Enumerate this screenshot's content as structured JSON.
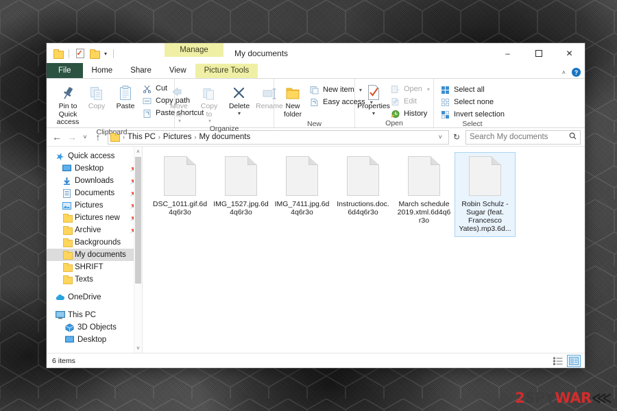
{
  "window": {
    "title": "My documents",
    "contextual_tab_title": "Manage",
    "contextual_tab_sub": "Picture Tools",
    "minimize": "–",
    "maximize": "☐",
    "close": "✕",
    "collapse_ribbon": "˄",
    "help": "?"
  },
  "quick_access_toolbar": {
    "new_folder": "new-folder-icon",
    "properties": "properties-icon",
    "folder": "folder-icon",
    "customize": "▾"
  },
  "tabs": [
    {
      "label": "File",
      "kind": "file"
    },
    {
      "label": "Home",
      "kind": "active"
    },
    {
      "label": "Share",
      "kind": "normal"
    },
    {
      "label": "View",
      "kind": "normal"
    },
    {
      "label": "Picture Tools",
      "kind": "contextual"
    }
  ],
  "ribbon": {
    "groups": [
      {
        "label": "Clipboard",
        "big": [
          {
            "label": "Pin to Quick\naccess",
            "icon": "pin-icon",
            "dim": false
          },
          {
            "label": "Copy",
            "icon": "copy-icon",
            "dim": true
          },
          {
            "label": "Paste",
            "icon": "paste-icon",
            "dim": false
          }
        ],
        "small": [
          {
            "label": "Cut",
            "icon": "scissors-icon",
            "dim": false
          },
          {
            "label": "Copy path",
            "icon": "copy-path-icon",
            "dim": false
          },
          {
            "label": "Paste shortcut",
            "icon": "paste-shortcut-icon",
            "dim": false
          }
        ]
      },
      {
        "label": "Organize",
        "big": [
          {
            "label": "Move\nto",
            "icon": "move-to-icon",
            "dim": true,
            "caret": true
          },
          {
            "label": "Copy\nto",
            "icon": "copy-to-icon",
            "dim": true,
            "caret": true
          },
          {
            "label": "Delete",
            "icon": "delete-icon",
            "dim": false,
            "caret": true
          },
          {
            "label": "Rename",
            "icon": "rename-icon",
            "dim": true
          }
        ],
        "small": []
      },
      {
        "label": "New",
        "big": [
          {
            "label": "New\nfolder",
            "icon": "new-folder-icon",
            "dim": false
          }
        ],
        "small": [
          {
            "label": "New item",
            "icon": "new-item-icon",
            "dim": false,
            "caret": true
          },
          {
            "label": "Easy access",
            "icon": "easy-access-icon",
            "dim": false,
            "caret": true
          }
        ]
      },
      {
        "label": "Open",
        "big": [
          {
            "label": "Properties",
            "icon": "properties-icon",
            "dim": false,
            "caret": true
          }
        ],
        "small": [
          {
            "label": "Open",
            "icon": "open-icon",
            "dim": true,
            "caret": true
          },
          {
            "label": "Edit",
            "icon": "edit-icon",
            "dim": true
          },
          {
            "label": "History",
            "icon": "history-icon",
            "dim": false
          }
        ]
      },
      {
        "label": "Select",
        "big": [],
        "small": [
          {
            "label": "Select all",
            "icon": "select-all-icon",
            "dim": false
          },
          {
            "label": "Select none",
            "icon": "select-none-icon",
            "dim": false
          },
          {
            "label": "Invert selection",
            "icon": "invert-selection-icon",
            "dim": false
          }
        ]
      }
    ]
  },
  "navigation": {
    "back": "←",
    "forward": "→",
    "recent": "˅",
    "up": "↑",
    "breadcrumbs": [
      "This PC",
      "Pictures",
      "My documents"
    ],
    "separator": "›",
    "dropdown": "˅",
    "refresh": "↻"
  },
  "search": {
    "placeholder": "Search My documents",
    "value": "",
    "icon": "search-icon"
  },
  "sidebar": {
    "items": [
      {
        "label": "Quick access",
        "icon": "star-icon",
        "indent": 0,
        "pinned": false,
        "selected": false
      },
      {
        "label": "Desktop",
        "icon": "desktop-icon",
        "indent": 1,
        "pinned": true,
        "selected": false
      },
      {
        "label": "Downloads",
        "icon": "download-icon",
        "indent": 1,
        "pinned": true,
        "selected": false
      },
      {
        "label": "Documents",
        "icon": "documents-icon",
        "indent": 1,
        "pinned": true,
        "selected": false
      },
      {
        "label": "Pictures",
        "icon": "pictures-icon",
        "indent": 1,
        "pinned": true,
        "selected": false
      },
      {
        "label": "Pictures new",
        "icon": "folder-icon",
        "indent": 1,
        "pinned": true,
        "selected": false
      },
      {
        "label": "Archive",
        "icon": "folder-icon",
        "indent": 1,
        "pinned": true,
        "selected": false
      },
      {
        "label": "Backgrounds",
        "icon": "folder-icon",
        "indent": 1,
        "pinned": false,
        "selected": false
      },
      {
        "label": "My documents",
        "icon": "folder-icon",
        "indent": 1,
        "pinned": false,
        "selected": true
      },
      {
        "label": "SHRIFT",
        "icon": "folder-icon",
        "indent": 1,
        "pinned": false,
        "selected": false
      },
      {
        "label": "Texts",
        "icon": "folder-icon",
        "indent": 1,
        "pinned": false,
        "selected": false
      },
      {
        "label": "__GAP__",
        "icon": "",
        "indent": 0,
        "pinned": false,
        "selected": false
      },
      {
        "label": "OneDrive",
        "icon": "cloud-icon",
        "indent": 0,
        "pinned": false,
        "selected": false
      },
      {
        "label": "__GAP__",
        "icon": "",
        "indent": 0,
        "pinned": false,
        "selected": false
      },
      {
        "label": "This PC",
        "icon": "pc-icon",
        "indent": 0,
        "pinned": false,
        "selected": false
      },
      {
        "label": "3D Objects",
        "icon": "3d-objects-icon",
        "indent": 1,
        "pinned": false,
        "selected": false
      },
      {
        "label": "Desktop",
        "icon": "desktop-icon",
        "indent": 1,
        "pinned": false,
        "selected": false
      }
    ],
    "scroll_up": "˄",
    "scroll_down": "˅"
  },
  "files": [
    {
      "name": "DSC_1011.gif.6d4q6r3o",
      "icon": "generic-file-icon",
      "selected": false
    },
    {
      "name": "IMG_1527.jpg.6d4q6r3o",
      "icon": "generic-file-icon",
      "selected": false
    },
    {
      "name": "IMG_7411.jpg.6d4q6r3o",
      "icon": "generic-file-icon",
      "selected": false
    },
    {
      "name": "Instructions.doc.6d4q6r3o",
      "icon": "generic-file-icon",
      "selected": false
    },
    {
      "name": "March schedule 2019.xtml.6d4q6r3o",
      "icon": "generic-file-icon",
      "selected": false
    },
    {
      "name": "Robin Schulz - Sugar (feat. Francesco Yates).mp3.6d...",
      "icon": "generic-file-icon",
      "selected": true
    }
  ],
  "statusbar": {
    "item_count": "6 items",
    "details_view": "details-view-icon",
    "large_icons_view": "large-icons-view-icon"
  },
  "watermark": {
    "part1": "2",
    "part2": "SPY",
    "part3": "WAR",
    "part4": "⋘"
  },
  "colors": {
    "file_tab": "#2c5242",
    "contextual_tab": "#eff0a5",
    "selection": "#eaf4fd",
    "selection_border": "#a8d4f5",
    "sidebar_selection": "#dcdcdc",
    "accent_blue": "#1673c2",
    "watermark_red": "#e02b2b"
  }
}
